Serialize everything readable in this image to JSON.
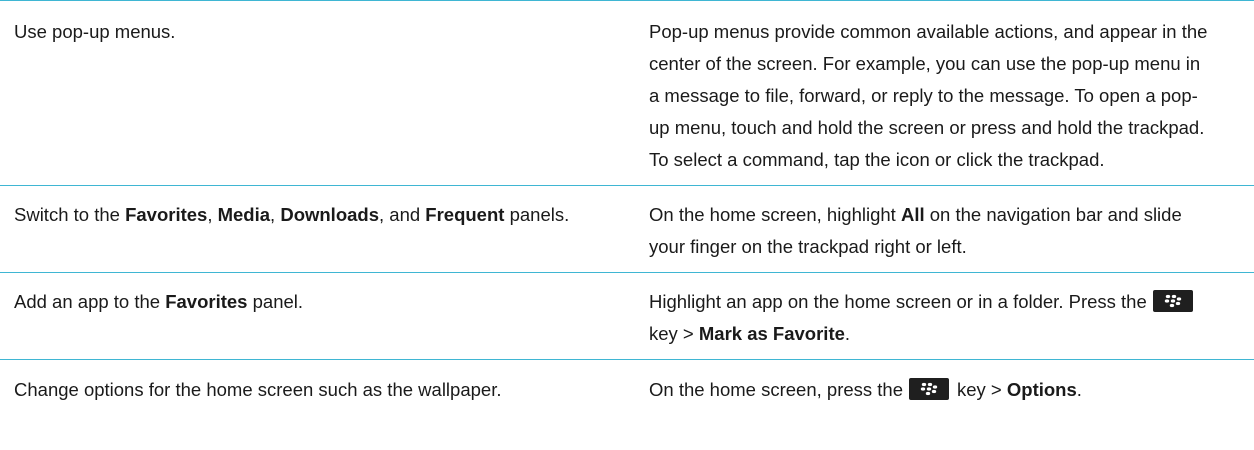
{
  "rows": [
    {
      "task": "Use pop-up menus.",
      "desc": "Pop-up menus provide common available actions, and appear in the center of the screen. For example, you can use the pop-up menu in a message to file, forward, or reply to the message. To open a pop-up menu, touch and hold the screen or press and hold the trackpad. To select a command, tap the icon or click the trackpad."
    },
    {
      "task": {
        "t1": "Switch to the ",
        "b1": "Favorites",
        "t2": ", ",
        "b2": "Media",
        "t3": ", ",
        "b3": "Downloads",
        "t4": ", and ",
        "b4": "Frequent",
        "t5": " panels."
      },
      "desc": {
        "t1": "On the home screen, highlight ",
        "b1": "All",
        "t2": " on the navigation bar and slide your finger on the trackpad right or left."
      }
    },
    {
      "task": {
        "t1": "Add an app to the ",
        "b1": "Favorites",
        "t2": " panel."
      },
      "desc": {
        "t1": "Highlight an app on the home screen or in a folder. Press the",
        "icon": "blackberry-menu-key-icon",
        "t2": "key > ",
        "b1": "Mark as Favorite",
        "t3": "."
      }
    },
    {
      "task": "Change options for the home screen such as the wallpaper.",
      "desc": {
        "t1": "On the home screen, press the",
        "icon": "blackberry-menu-key-icon",
        "t2": "key > ",
        "b1": "Options",
        "t3": "."
      }
    }
  ],
  "colors": {
    "rule": "#3fb6d3",
    "text": "#1a1a1a",
    "key_bg": "#1f1f1f"
  }
}
